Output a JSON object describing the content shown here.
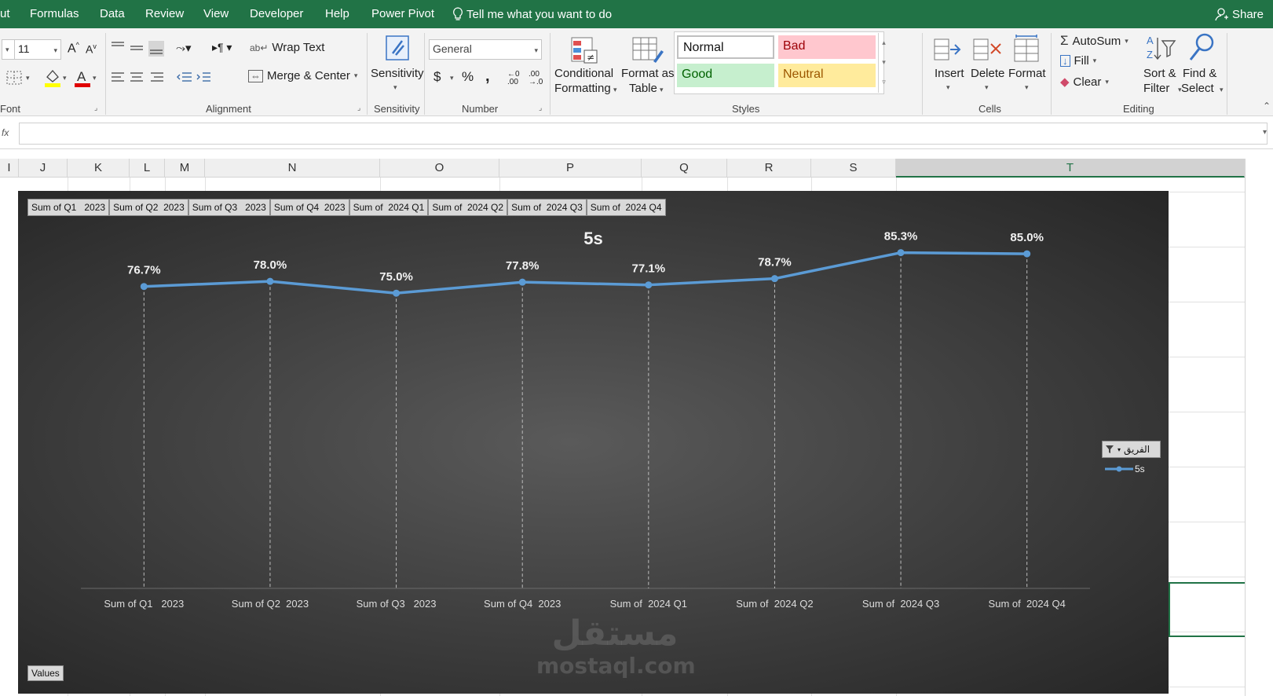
{
  "menu": {
    "items": [
      "ut",
      "Formulas",
      "Data",
      "Review",
      "View",
      "Developer",
      "Help",
      "Power Pivot"
    ],
    "tell_me": "Tell me what you want to do",
    "share": "Share"
  },
  "ribbon": {
    "font": {
      "size": "11",
      "label": "Font"
    },
    "alignment": {
      "wrap_text": "Wrap Text",
      "merge_center": "Merge & Center",
      "label": "Alignment"
    },
    "sensitivity": {
      "button": "Sensitivity",
      "label": "Sensitivity"
    },
    "number": {
      "format": "General",
      "currency": "$",
      "percent": "%",
      "comma": ",",
      "label": "Number"
    },
    "styles": {
      "conditional": "Conditional",
      "conditional2": "Formatting",
      "format_as": "Format as",
      "format_as2": "Table",
      "normal": "Normal",
      "bad": "Bad",
      "good": "Good",
      "neutral": "Neutral",
      "label": "Styles"
    },
    "cells": {
      "insert": "Insert",
      "delete": "Delete",
      "format": "Format",
      "label": "Cells"
    },
    "editing": {
      "autosum": "AutoSum",
      "fill": "Fill",
      "clear": "Clear",
      "sort": "Sort &",
      "sort2": "Filter",
      "find": "Find &",
      "find2": "Select",
      "label": "Editing"
    }
  },
  "sheet": {
    "columns": [
      "I",
      "J",
      "K",
      "L",
      "M",
      "N",
      "O",
      "P",
      "Q",
      "R",
      "S",
      "T"
    ],
    "selected_column": "T"
  },
  "chart": {
    "field_buttons": [
      "Sum of Q1   2023",
      "Sum of Q2  2023",
      "Sum of Q3   2023",
      "Sum of Q4  2023",
      "Sum of  2024 Q1",
      "Sum of  2024 Q2",
      "Sum of  2024 Q3",
      "Sum of  2024 Q4"
    ],
    "legend_filter": "الفريق",
    "values_button": "Values",
    "watermark_arabic": "مستقل",
    "watermark_latin": "mostaql.com",
    "line_color": "#5b9bd5"
  },
  "chart_data": {
    "type": "line",
    "title": "5s",
    "categories": [
      "Sum of Q1   2023",
      "Sum of Q2  2023",
      "Sum of Q3   2023",
      "Sum of Q4  2023",
      "Sum of  2024 Q1",
      "Sum of  2024 Q2",
      "Sum of  2024 Q3",
      "Sum of  2024 Q4"
    ],
    "series": [
      {
        "name": "5s",
        "values": [
          0.767,
          0.78,
          0.75,
          0.778,
          0.771,
          0.787,
          0.853,
          0.85
        ]
      }
    ],
    "data_labels": [
      "76.7%",
      "78.0%",
      "75.0%",
      "77.8%",
      "77.1%",
      "78.7%",
      "85.3%",
      "85.0%"
    ],
    "ylim": [
      0.0,
      0.95
    ],
    "grid": "vertical drop lines",
    "legend": "right"
  }
}
